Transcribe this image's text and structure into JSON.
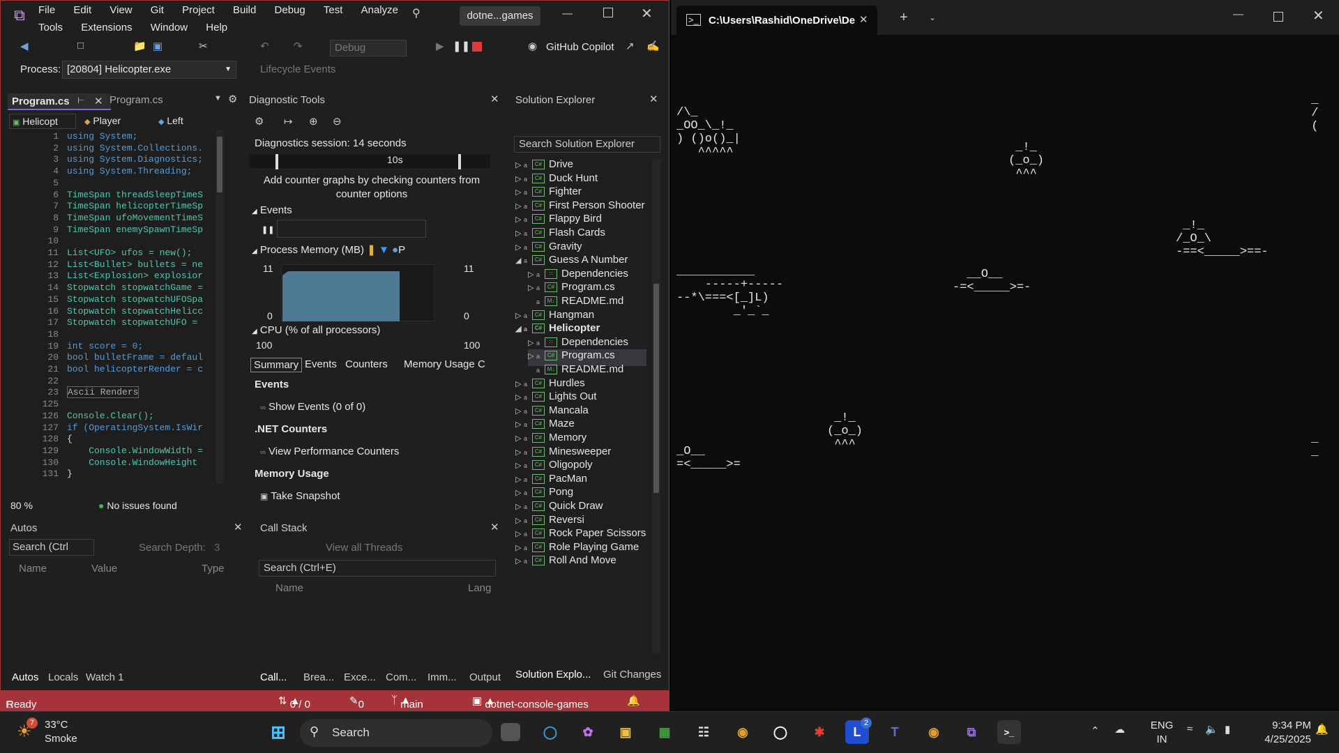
{
  "vs": {
    "menu": [
      "File",
      "Edit",
      "View",
      "Git",
      "Project",
      "Build",
      "Debug",
      "Test",
      "Analyze"
    ],
    "menu2": [
      "Tools",
      "Extensions",
      "Window",
      "Help"
    ],
    "solution_badge": "dotne...games",
    "debug_config": "Debug",
    "copilot": "GitHub Copilot",
    "process_label": "Process:",
    "process_value": "[20804] Helicopter.exe",
    "lifecycle": "Lifecycle Events",
    "tabs": {
      "active": "Program.cs",
      "other": "Program.cs"
    },
    "nav": {
      "class": "Helicopt",
      "member": "Player",
      "member2": "Left"
    },
    "zoom": "80 %",
    "issues": "No issues found",
    "code": [
      {
        "n": "1",
        "t": "using System;"
      },
      {
        "n": "2",
        "t": "using System.Collections."
      },
      {
        "n": "3",
        "t": "using System.Diagnostics;"
      },
      {
        "n": "4",
        "t": "using System.Threading;"
      },
      {
        "n": "5",
        "t": ""
      },
      {
        "n": "6",
        "t": "TimeSpan threadSleepTimeS"
      },
      {
        "n": "7",
        "t": "TimeSpan helicopterTimeSp"
      },
      {
        "n": "8",
        "t": "TimeSpan ufoMovementTimeS"
      },
      {
        "n": "9",
        "t": "TimeSpan enemySpawnTimeSp"
      },
      {
        "n": "10",
        "t": ""
      },
      {
        "n": "11",
        "t": "List<UFO> ufos = new();"
      },
      {
        "n": "12",
        "t": "List<Bullet> bullets = ne"
      },
      {
        "n": "13",
        "t": "List<Explosion> explosior"
      },
      {
        "n": "14",
        "t": "Stopwatch stopwatchGame ="
      },
      {
        "n": "15",
        "t": "Stopwatch stopwatchUFOSpa"
      },
      {
        "n": "16",
        "t": "Stopwatch stopwatchHelicc"
      },
      {
        "n": "17",
        "t": "Stopwatch stopwatchUFO ="
      },
      {
        "n": "18",
        "t": ""
      },
      {
        "n": "19",
        "t": "int score = 0;"
      },
      {
        "n": "20",
        "t": "bool bulletFrame = defaul"
      },
      {
        "n": "21",
        "t": "bool helicopterRender = c"
      },
      {
        "n": "22",
        "t": ""
      },
      {
        "n": "23",
        "t": "Ascii Renders"
      },
      {
        "n": "125",
        "t": ""
      },
      {
        "n": "126",
        "t": "Console.Clear();"
      },
      {
        "n": "127",
        "t": "if (OperatingSystem.IsWir"
      },
      {
        "n": "128",
        "t": "{"
      },
      {
        "n": "129",
        "t": "    Console.WindowWidth ="
      },
      {
        "n": "130",
        "t": "    Console.WindowHeight "
      },
      {
        "n": "131",
        "t": "}"
      }
    ],
    "diag": {
      "title": "Diagnostic Tools",
      "session": "Diagnostics session: 14 seconds",
      "tick": "10s",
      "hint": "Add counter graphs by checking counters from counter options",
      "events": "Events",
      "mem": "Process Memory (MB)",
      "mem_p": "P",
      "mem_max": "11",
      "mem_min": "0",
      "cpu": "CPU (% of all processors)",
      "cpu_max": "100",
      "tabs": [
        "Summary",
        "Events",
        "Counters",
        "Memory Usage",
        "C"
      ],
      "sec_events": "Events",
      "show_events": "Show Events (0 of 0)",
      "sec_net": ".NET Counters",
      "view_perf": "View Performance Counters",
      "sec_mem": "Memory Usage",
      "snapshot": "Take Snapshot"
    },
    "se": {
      "title": "Solution Explorer",
      "search": "Search Solution Explorer",
      "items": [
        {
          "label": "Drive",
          "lvl": 0,
          "exp": "▷"
        },
        {
          "label": "Duck Hunt",
          "lvl": 0,
          "exp": "▷"
        },
        {
          "label": "Fighter",
          "lvl": 0,
          "exp": "▷"
        },
        {
          "label": "First Person Shooter",
          "lvl": 0,
          "exp": "▷"
        },
        {
          "label": "Flappy Bird",
          "lvl": 0,
          "exp": "▷"
        },
        {
          "label": "Flash Cards",
          "lvl": 0,
          "exp": "▷"
        },
        {
          "label": "Gravity",
          "lvl": 0,
          "exp": "▷"
        },
        {
          "label": "Guess A Number",
          "lvl": 0,
          "exp": "◢"
        },
        {
          "label": "Dependencies",
          "lvl": 1,
          "exp": "▷"
        },
        {
          "label": "Program.cs",
          "lvl": 1,
          "exp": "▷"
        },
        {
          "label": "README.md",
          "lvl": 1,
          "exp": ""
        },
        {
          "label": "Hangman",
          "lvl": 0,
          "exp": "▷"
        },
        {
          "label": "Helicopter",
          "lvl": 0,
          "exp": "◢"
        },
        {
          "label": "Dependencies",
          "lvl": 1,
          "exp": "▷"
        },
        {
          "label": "Program.cs",
          "lvl": 1,
          "exp": "▷"
        },
        {
          "label": "README.md",
          "lvl": 1,
          "exp": ""
        },
        {
          "label": "Hurdles",
          "lvl": 0,
          "exp": "▷"
        },
        {
          "label": "Lights Out",
          "lvl": 0,
          "exp": "▷"
        },
        {
          "label": "Mancala",
          "lvl": 0,
          "exp": "▷"
        },
        {
          "label": "Maze",
          "lvl": 0,
          "exp": "▷"
        },
        {
          "label": "Memory",
          "lvl": 0,
          "exp": "▷"
        },
        {
          "label": "Minesweeper",
          "lvl": 0,
          "exp": "▷"
        },
        {
          "label": "Oligopoly",
          "lvl": 0,
          "exp": "▷"
        },
        {
          "label": "PacMan",
          "lvl": 0,
          "exp": "▷"
        },
        {
          "label": "Pong",
          "lvl": 0,
          "exp": "▷"
        },
        {
          "label": "Quick Draw",
          "lvl": 0,
          "exp": "▷"
        },
        {
          "label": "Reversi",
          "lvl": 0,
          "exp": "▷"
        },
        {
          "label": "Rock Paper Scissors",
          "lvl": 0,
          "exp": "▷"
        },
        {
          "label": "Role Playing Game",
          "lvl": 0,
          "exp": "▷"
        },
        {
          "label": "Roll And Move",
          "lvl": 0,
          "exp": "▷"
        }
      ],
      "bottom_tabs": [
        "Solution Explo...",
        "Git Changes"
      ]
    },
    "autos": {
      "title": "Autos",
      "search": "Search (Ctrl",
      "depth": "Search Depth:",
      "depth_val": "3",
      "cols": [
        "Name",
        "Value",
        "Type"
      ],
      "tabs": [
        "Autos",
        "Locals",
        "Watch 1"
      ]
    },
    "callstack": {
      "title": "Call Stack",
      "threads": "View all Threads",
      "search": "Search (Ctrl+E)",
      "cols": [
        "Name",
        "Lang"
      ],
      "tabs": [
        "Call...",
        "Brea...",
        "Exce...",
        "Com...",
        "Imm...",
        "Output"
      ]
    },
    "status": {
      "ready": "Ready",
      "lines": "0 / 0",
      "edits": "0",
      "branch": "main",
      "repo": "dotnet-console-games"
    }
  },
  "terminal": {
    "title": "C:\\Users\\Rashid\\OneDrive\\De"
  },
  "taskbar": {
    "weather_temp": "33°C",
    "weather_desc": "Smoke",
    "search": "Search",
    "lang1": "ENG",
    "lang2": "IN",
    "time": "9:34 PM",
    "date": "4/25/2025",
    "badge_teams": "2",
    "badge_weather": "7"
  }
}
